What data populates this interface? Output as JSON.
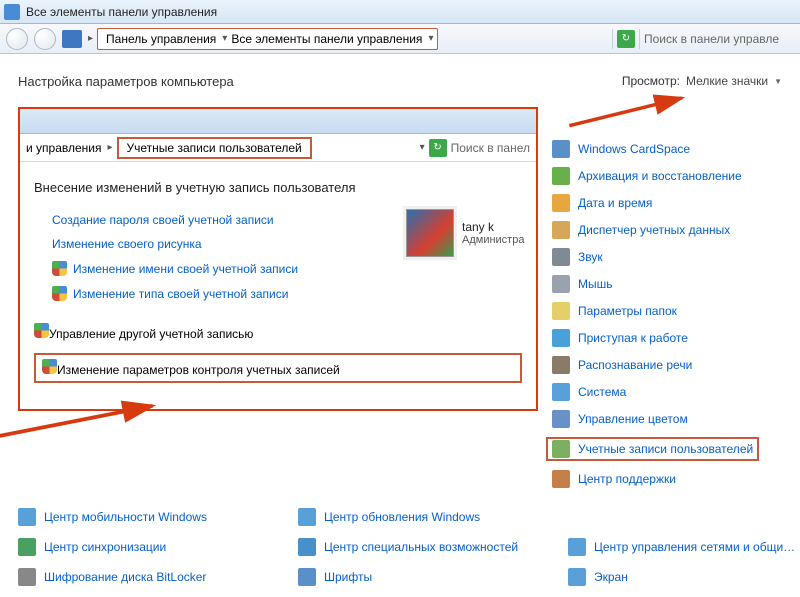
{
  "window": {
    "title": "Все элементы панели управления"
  },
  "nav": {
    "bc1": "Панель управления",
    "bc2": "Все элементы панели управления",
    "search_placeholder": "Поиск в панели управле"
  },
  "head": {
    "title": "Настройка параметров компьютера",
    "view_label": "Просмотр:",
    "view_value": "Мелкие значки"
  },
  "inset": {
    "bc_outer": "и управления",
    "bc_user": "Учетные записи пользователей",
    "search": "Поиск в панел",
    "heading": "Внесение изменений в учетную запись пользователя",
    "links1": [
      "Создание пароля своей учетной записи",
      "Изменение своего рисунка",
      "Изменение имени своей учетной записи",
      "Изменение типа своей учетной записи"
    ],
    "links2": [
      "Управление другой учетной записью",
      "Изменение параметров контроля учетных записей"
    ],
    "user_name": "tany k",
    "user_role": "Администра"
  },
  "right": [
    "Windows CardSpace",
    "Архивация и восстановление",
    "Дата и время",
    "Диспетчер учетных данных",
    "Звук",
    "Мышь",
    "Параметры папок",
    "Приступая к работе",
    "Распознавание речи",
    "Система",
    "Управление цветом",
    "Учетные записи пользователей",
    "Центр поддержки"
  ],
  "bottom": [
    "Центр мобильности Windows",
    "Центр обновления Windows",
    "",
    "Центр синхронизации",
    "Центр специальных возможностей",
    "Центр управления сетями и общи…",
    "Шифрование диска BitLocker",
    "Шрифты",
    "Экран"
  ],
  "icon_colors": {
    "right": [
      "#5a90c8",
      "#6ab04a",
      "#e6a740",
      "#d6a75a",
      "#808a94",
      "#9aa3ad",
      "#e6cf6a",
      "#4aa0d8",
      "#8a7a68",
      "#5aa0d8",
      "#6a90c8",
      "#7ab060",
      "#c47f4a"
    ],
    "bottom": [
      "#5aa0d8",
      "#5aa0d8",
      "",
      "#4aa060",
      "#4a90c8",
      "#5aa0d8",
      "#888",
      "#5a90c8",
      "#5aa0d8"
    ]
  }
}
